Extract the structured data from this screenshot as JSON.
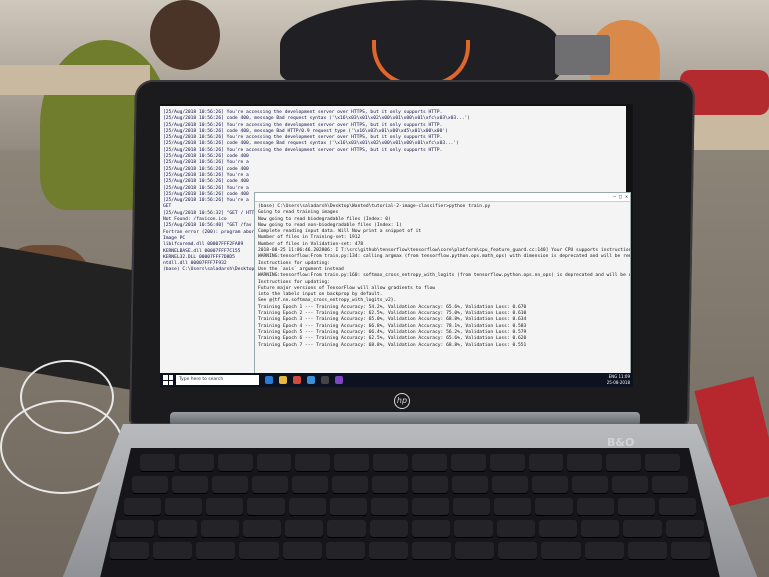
{
  "scene": {
    "device_logo": "hp",
    "model_badge": "B&O",
    "colors": {
      "laptop_body": "#1b1b1d",
      "terminal_bg": "#f4f4f4",
      "taskbar": "#0c1220",
      "card": "#b6272e"
    }
  },
  "bg_terminal": {
    "lines": [
      "[25/Aug/2018 10:56:26] You're accessing the development server over HTTPS, but it only supports HTTP.",
      "[25/Aug/2018 10:56:26] code 400, message Bad request syntax ('\\x16\\x03\\x01\\x02\\x00\\x01\\x00\\x01\\xfc\\x03\\x03...')",
      "[25/Aug/2018 10:56:26] You're accessing the development server over HTTPS, but it only supports HTTP.",
      "[25/Aug/2018 10:56:26] code 400, message Bad HTTP/0.9 request type ('\\x16\\x03\\x01\\x00\\xd5\\x01\\x00\\x00')",
      "[25/Aug/2018 10:56:26] You're accessing the development server over HTTPS, but it only supports HTTP.",
      "[25/Aug/2018 10:56:26] code 400, message Bad request syntax ('\\x16\\x03\\x01\\x02\\x00\\x01\\x00\\x01\\xfc\\x03...')",
      "[25/Aug/2018 10:56:26] You're accessing the development server over HTTPS, but it only supports HTTP.",
      "[25/Aug/2018 10:56:26] code 400",
      "[25/Aug/2018 10:56:26] You're a",
      "[25/Aug/2018 10:56:26] code 400",
      "[25/Aug/2018 10:56:26] You're a",
      "[25/Aug/2018 10:56:26] code 400",
      "[25/Aug/2018 10:56:26] You're a",
      "[25/Aug/2018 10:56:26] code 400",
      "[25/Aug/2018 10:56:26] You're a",
      "GET",
      "[25/Aug/2018 10:56:32] \"GET / HTTP",
      "Not Found: /favicon.ico",
      "[25/Aug/2018 10:56:40] \"GET /fav",
      "Fortran error (200): program abort",
      "Image                 PC",
      "libifcoremd.dll      00007FFF2FA89",
      "KERNELBASE.dll       00007FFF7C155",
      "KERNEL32.DLL         00007FFF7D8D5",
      "ntdll.dll            00007FFF7F932",
      "",
      "(base) C:\\Users\\saladarsh\\Desktop>"
    ]
  },
  "fg_terminal": {
    "lines": [
      "(base) C:\\Users\\saladarsh\\Desktop\\Wanted\\tutorial-2-image-classifier>python train.py",
      "Going to read training images",
      "Now going to read biodegradable files (Index: 0)",
      "Now going to read non-biodegradable files (Index: 1)",
      "Complete reading input data. Will Now print a snippet of it",
      "Number of files in Training-set:          1912",
      "Number of files in Validation-set:         478",
      "2018-08-25 11:06:46.202806: I T:\\src\\github\\tensorflow\\tensorflow\\core\\platform\\cpu_feature_guard.cc:140] Your CPU supports instructions that this TensorFlow binary was not compiled to use: AVX2",
      "WARNING:tensorflow:From train.py:134: calling argmax (from tensorflow.python.ops.math_ops) with dimension is deprecated and will be removed in a future version.",
      "Instructions for updating:",
      "Use the `axis` argument instead",
      "WARNING:tensorflow:From train.py:160: softmax_cross_entropy_with_logits (from tensorflow.python.ops.nn_ops) is deprecated and will be removed in a future version.",
      "Instructions for updating:",
      "",
      "Future major versions of TensorFlow will allow gradients to flow",
      "into the labels input on backprop by default.",
      "",
      "See @{tf.nn.softmax_cross_entropy_with_logits_v2}.",
      "",
      "Training Epoch 1 --- Training Accuracy:  54.2%, Validation Accuracy:  65.6%,  Validation Loss: 0.670",
      "Training Epoch 2 --- Training Accuracy:  62.5%, Validation Accuracy:  75.0%,  Validation Loss: 0.610",
      "Training Epoch 3 --- Training Accuracy:  65.0%, Validation Accuracy:  68.8%,  Validation Loss: 0.634",
      "Training Epoch 4 --- Training Accuracy:  66.8%, Validation Accuracy:  78.1%,  Validation Loss: 0.583",
      "Training Epoch 5 --- Training Accuracy:  66.4%, Validation Accuracy:  56.2%,  Validation Loss: 0.579",
      "Training Epoch 6 --- Training Accuracy:  62.5%, Validation Accuracy:  65.6%,  Validation Loss: 0.620",
      "Training Epoch 7 --- Training Accuracy:  68.8%, Validation Accuracy:  68.8%,  Validation Loss: 0.551"
    ]
  },
  "taskbar": {
    "search_placeholder": "Type here to search",
    "time": "11:09",
    "date": "25-08-2018",
    "lang": "ENG"
  }
}
